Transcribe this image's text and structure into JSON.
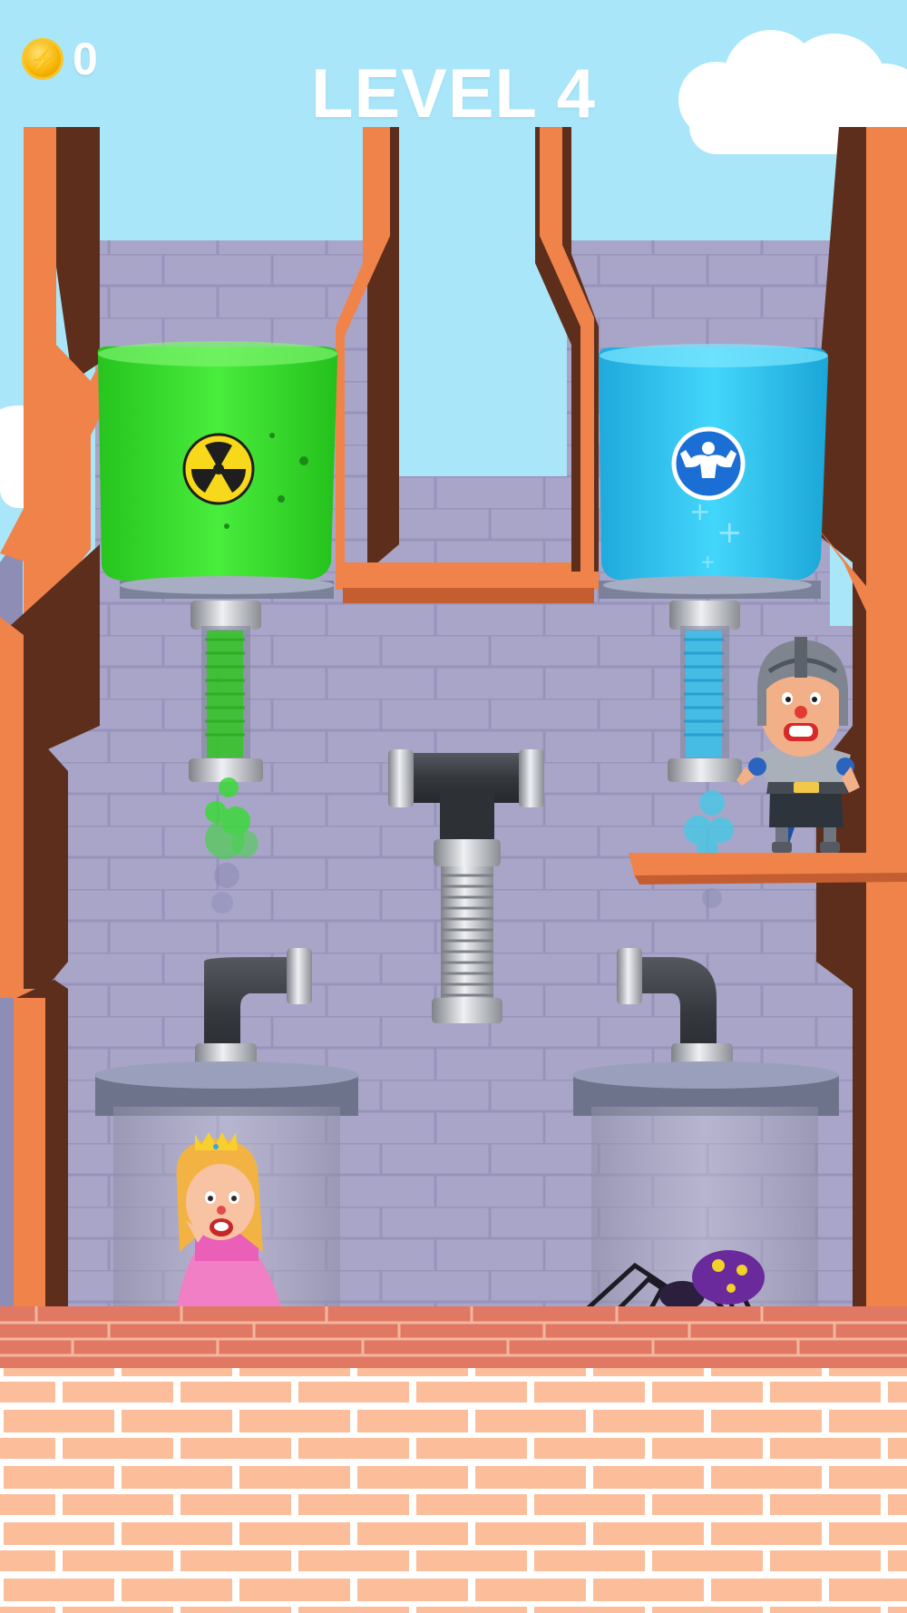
{
  "hud": {
    "coins": "0",
    "coin_icon": "lightning-coin-icon",
    "level_title": "LEVEL 4"
  },
  "tanks": [
    {
      "name": "poison-tank",
      "contents": "green poison",
      "icon": "radiation-icon",
      "color": "#3fe03a"
    },
    {
      "name": "strength-tank",
      "contents": "blue strength potion",
      "icon": "muscle-icon",
      "color": "#36c8f4"
    }
  ],
  "pipes": [
    "t-junction-pipe",
    "left-elbow-pipe",
    "right-elbow-pipe"
  ],
  "characters": [
    "knight-hero",
    "princess",
    "purple-spider"
  ],
  "colors": {
    "sky": "#a9e6fa",
    "castle_wall": "#a7a3c6",
    "orange_frame": "#f0834a",
    "floor_brick": "#fbbd99"
  }
}
